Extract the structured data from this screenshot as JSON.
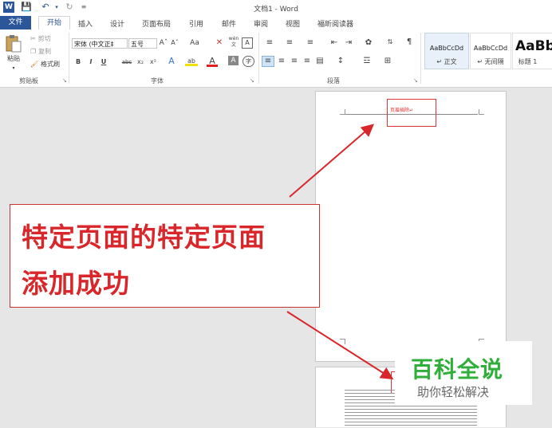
{
  "window": {
    "title": "文档1 - Word"
  },
  "tabs": [
    "文件",
    "开始",
    "插入",
    "设计",
    "页面布局",
    "引用",
    "邮件",
    "审阅",
    "视图",
    "福昕阅读器"
  ],
  "clipboard": {
    "paste": "粘贴",
    "cut": "剪切",
    "copy": "复制",
    "format_painter": "格式刷",
    "group": "剪贴板"
  },
  "font": {
    "name": "宋体 (中文正‡",
    "size": "五号",
    "change_case": "Aa",
    "group": "字体",
    "bold": "B",
    "italic": "I",
    "underline": "U",
    "strike": "abc",
    "sub": "x₂",
    "sup": "x²",
    "grow": "Aˆ",
    "shrink": "Aˇ",
    "text_effects": "A",
    "highlight": "ab",
    "font_color": "A",
    "char_shading": "A",
    "enclose": "字",
    "phonetic": "wén",
    "clear": "A",
    "border": "A"
  },
  "paragraph": {
    "group": "段落"
  },
  "styles": [
    {
      "sample": "AaBbCcDd",
      "name": "↵ 正文"
    },
    {
      "sample": "AaBbCcDd",
      "name": "↵ 无间隔"
    },
    {
      "sample": "AaBb",
      "name": "标题 1"
    }
  ],
  "document": {
    "header_text": "页眉插除↵"
  },
  "annotation": {
    "line1": "特定页面的特定页面",
    "line2": "添加成功"
  },
  "watermark": {
    "brand": "百科全说",
    "slogan": "助你轻松解决"
  },
  "colors": {
    "accent": "#2b579a",
    "annotation_red": "#d9262a",
    "brand_green": "#2fae3a"
  }
}
